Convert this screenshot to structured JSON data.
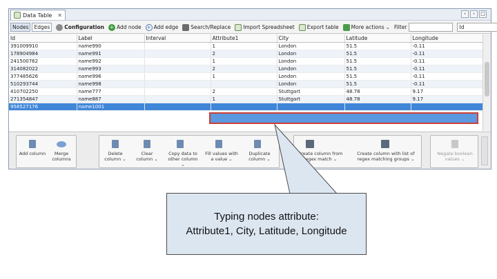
{
  "titlebar": {
    "tab_label": "Data Table",
    "close_glyph": "✕",
    "window_buttons": [
      "‹",
      "›",
      "□"
    ]
  },
  "toolbar": {
    "nodes_label": "Nodes",
    "edges_label": "Edges",
    "configuration_label": "Configuration",
    "add_node_label": "Add node",
    "add_edge_label": "Add edge",
    "search_replace_label": "Search/Replace",
    "import_label": "Import Spreadsheet",
    "export_label": "Export table",
    "more_actions_label": "More actions",
    "filter_label": "Filter",
    "filter_value": "",
    "column_select_value": "Id"
  },
  "table": {
    "columns": [
      "Id",
      "Label",
      "Interval",
      "Attribute1",
      "City",
      "Latitude",
      "Longitude"
    ],
    "rows": [
      [
        "391009910",
        "name990",
        "",
        "1",
        "London",
        "51.5",
        "-0.11"
      ],
      [
        "178904984",
        "name991",
        "",
        "2",
        "London",
        "51.5",
        "-0.11"
      ],
      [
        "241500762",
        "name992",
        "",
        "1",
        "London",
        "51.5",
        "-0.11"
      ],
      [
        "314082022",
        "name993",
        "",
        "2",
        "London",
        "51.5",
        "-0.11"
      ],
      [
        "377485626",
        "name996",
        "",
        "1",
        "London",
        "51.5",
        "-0.11"
      ],
      [
        "510293744",
        "name998",
        "",
        "",
        "London",
        "51.5",
        "-0.11"
      ],
      [
        "410702250",
        "name777",
        "",
        "2",
        "Stuttgart",
        "48.78",
        "9.17"
      ],
      [
        "271354847",
        "name887",
        "",
        "1",
        "Stuttgart",
        "48.78",
        "9.17"
      ],
      [
        "958527176",
        "name1001",
        "",
        "",
        "",
        "",
        ""
      ]
    ],
    "selected_row_index": 8
  },
  "actions": {
    "items": [
      "Add column",
      "Merge columns",
      "Delete column ⌄",
      "Clear column ⌄",
      "Copy data to other column ⌄",
      "Fill values with a value ⌄",
      "Duplicate column ⌄",
      "Create column from regex match ⌄",
      "Create column with list of regex matching groups ⌄",
      "Negate boolean values ⌄"
    ]
  },
  "callout": {
    "line1": "Typing nodes attribute:",
    "line2": "Attribute1, City, Latitude, Longitude"
  },
  "colors": {
    "selected_row": "#3f86d9",
    "highlight_border": "#cf3d32",
    "callout_fill": "#dce6f1"
  }
}
